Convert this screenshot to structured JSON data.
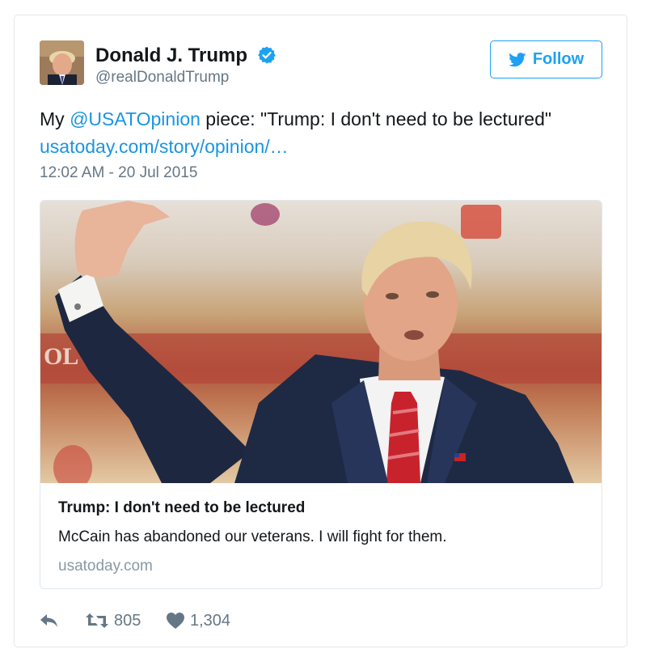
{
  "user": {
    "display_name": "Donald J. Trump",
    "handle": "@realDonaldTrump",
    "verified_icon": "verified-badge-icon"
  },
  "follow_button": {
    "label": "Follow",
    "icon": "twitter-bird-icon"
  },
  "tweet": {
    "prefix": "My ",
    "mention": "@USATOpinion",
    "middle": " piece: \"Trump: I don't need to be lectured\"",
    "url": "usatoday.com/story/opinion/…",
    "timestamp": "12:02 AM - 20 Jul 2015"
  },
  "link_card": {
    "title": "Trump: I don't need to be lectured",
    "description": "McCain has abandoned our veterans. I will fight for them.",
    "domain": "usatoday.com"
  },
  "actions": {
    "reply_icon": "reply-icon",
    "retweet_icon": "retweet-icon",
    "retweets": "805",
    "like_icon": "heart-icon",
    "likes": "1,304"
  },
  "colors": {
    "accent": "#1da1f2",
    "link": "#1b95e0",
    "muted": "#657786"
  }
}
